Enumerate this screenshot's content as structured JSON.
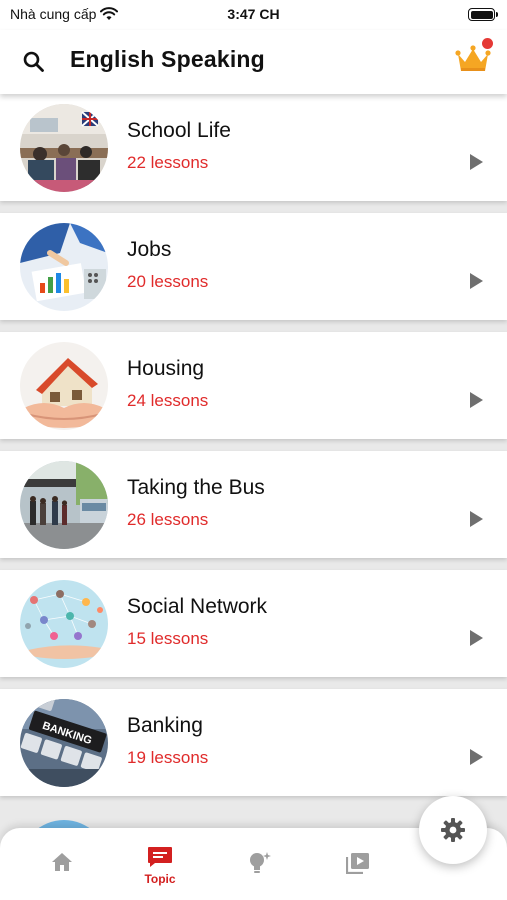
{
  "status_bar": {
    "carrier": "Nhà cung cấp",
    "time": "3:47 CH"
  },
  "header": {
    "title": "English Speaking",
    "premium_badge": true
  },
  "topics": [
    {
      "title": "School Life",
      "count": "22 lessons",
      "image": "classroom-photo"
    },
    {
      "title": "Jobs",
      "count": "20 lessons",
      "image": "business-charts-photo"
    },
    {
      "title": "Housing",
      "count": "24 lessons",
      "image": "house-in-hands-photo"
    },
    {
      "title": "Taking the Bus",
      "count": "26 lessons",
      "image": "bus-station-photo"
    },
    {
      "title": "Social Network",
      "count": "15 lessons",
      "image": "social-network-photo"
    },
    {
      "title": "Banking",
      "count": "19 lessons",
      "image": "banking-keyboard-photo",
      "image_text": "BANKING"
    }
  ],
  "bottom_nav": {
    "items": [
      {
        "id": "home",
        "label": "",
        "icon": "home-icon"
      },
      {
        "id": "topic",
        "label": "Topic",
        "icon": "topic-icon",
        "active": true
      },
      {
        "id": "ideas",
        "label": "",
        "icon": "lightbulb-icon"
      },
      {
        "id": "videos",
        "label": "",
        "icon": "video-library-icon"
      }
    ]
  },
  "fab": {
    "icon": "gear-icon"
  },
  "colors": {
    "accent": "#e02b2b",
    "crown": "#f5a623",
    "nav_inactive": "#9e9e9e",
    "play": "#6f6f6f"
  }
}
